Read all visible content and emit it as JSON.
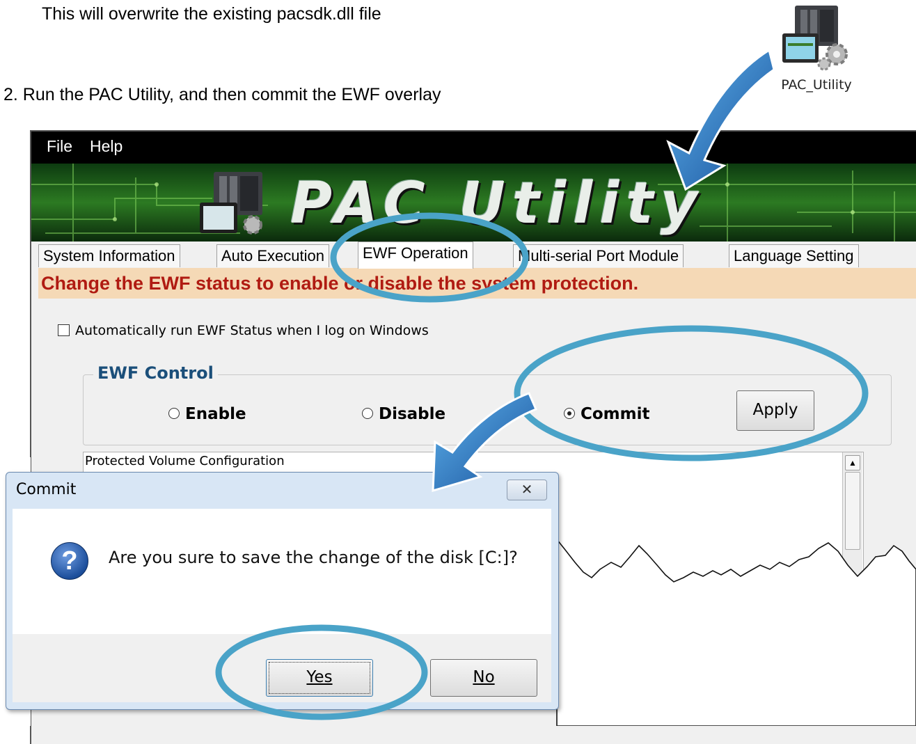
{
  "instructions": {
    "overwrite_note": "This will overwrite the existing pacsdk.dll file",
    "step2": "2.  Run the PAC Utility, and then commit the EWF overlay"
  },
  "desktop_icon": {
    "label": "PAC_Utility",
    "icon": "pac-utility-app-icon"
  },
  "pac_window": {
    "menu": [
      "File",
      "Help"
    ],
    "banner_title": "PAC Utility",
    "tabs": [
      "System Information",
      "Auto Execution",
      "EWF Operation",
      "Multi-serial Port Module",
      "Language Setting"
    ],
    "active_tab": "EWF Operation",
    "description": "Change the EWF status to enable or disable the system protection.",
    "auto_run_label": "Automatically run EWF Status when I log on Windows",
    "auto_run_checked": false,
    "ewf_control": {
      "legend": "EWF Control",
      "options": [
        "Enable",
        "Disable",
        "Commit"
      ],
      "selected": "Commit",
      "apply_label": "Apply"
    },
    "protected_volume_title": "Protected Volume Configuration"
  },
  "dialog": {
    "title": "Commit",
    "close_glyph": "✕",
    "icon": "question-icon",
    "message": "Are you sure to save the change of the disk [C:]?",
    "yes_label": "Yes",
    "no_label": "No"
  },
  "colors": {
    "description_text": "#b01b12",
    "description_bg": "#f5d9b6",
    "highlight_ring": "#4aa3c8",
    "arrow_blue": "#1f6fc4",
    "legend_text": "#1b4f7a"
  }
}
